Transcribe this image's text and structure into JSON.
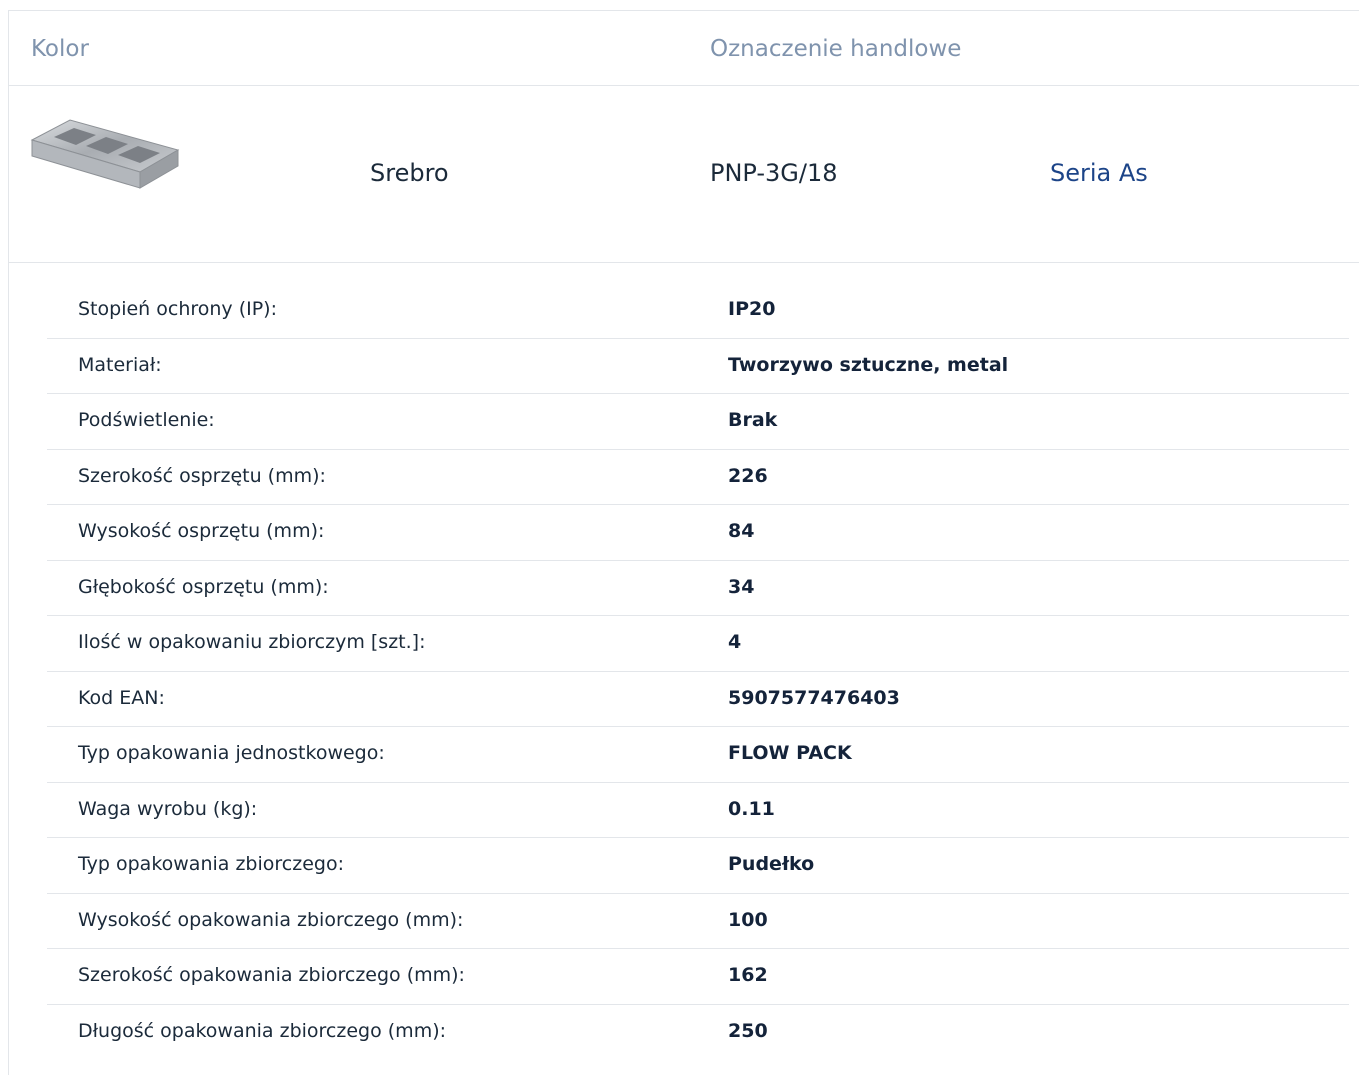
{
  "header": {
    "color_label": "Kolor",
    "trade_label": "Oznaczenie handlowe"
  },
  "product": {
    "image_icon": "metal-frame-3g-image",
    "color": "Srebro",
    "trade_name": "PNP-3G/18",
    "series_link": "Seria As",
    "link_color": "#1c4488"
  },
  "specs": [
    {
      "label": "Stopień ochrony (IP):",
      "value": "IP20"
    },
    {
      "label": "Materiał:",
      "value": "Tworzywo sztuczne, metal"
    },
    {
      "label": "Podświetlenie:",
      "value": "Brak"
    },
    {
      "label": "Szerokość osprzętu (mm):",
      "value": "226"
    },
    {
      "label": "Wysokość osprzętu (mm):",
      "value": "84"
    },
    {
      "label": "Głębokość osprzętu (mm):",
      "value": "34"
    },
    {
      "label": "Ilość w opakowaniu zbiorczym [szt.]:",
      "value": "4"
    },
    {
      "label": "Kod EAN:",
      "value": "5907577476403"
    },
    {
      "label": "Typ opakowania jednostkowego:",
      "value": "FLOW PACK"
    },
    {
      "label": "Waga wyrobu (kg):",
      "value": "0.11"
    },
    {
      "label": "Typ opakowania zbiorczego:",
      "value": "Pudełko"
    },
    {
      "label": "Wysokość opakowania zbiorczego (mm):",
      "value": "100"
    },
    {
      "label": "Szerokość opakowania zbiorczego (mm):",
      "value": "162"
    },
    {
      "label": "Długość opakowania zbiorczego (mm):",
      "value": "250"
    }
  ]
}
